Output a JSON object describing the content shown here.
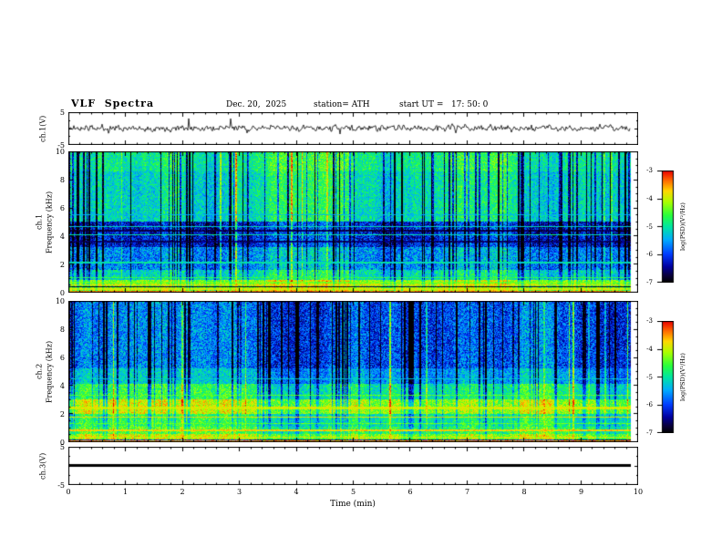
{
  "header": {
    "title": "VLF  Spectra",
    "date": "Dec. 20,  2025",
    "station": "station= ATH",
    "start_ut": "start UT =   17: 50: 0"
  },
  "x_axis": {
    "label": "Time  (min)",
    "range": [
      0,
      10
    ],
    "ticks": [
      "0",
      "1",
      "2",
      "3",
      "4",
      "5",
      "6",
      "7",
      "8",
      "9",
      "10"
    ],
    "minor_step": 0.2,
    "data_end": 9.87
  },
  "colorbar": {
    "label": "log(PSD)(V²/Hz)",
    "range": [
      -7,
      -3
    ],
    "ticks": [
      "-3",
      "-4",
      "-5",
      "-6",
      "-7"
    ],
    "stops": [
      {
        "t": 0.0,
        "c": [
          0,
          0,
          0
        ]
      },
      {
        "t": 0.06,
        "c": [
          10,
          0,
          60
        ]
      },
      {
        "t": 0.14,
        "c": [
          0,
          0,
          160
        ]
      },
      {
        "t": 0.25,
        "c": [
          0,
          60,
          255
        ]
      },
      {
        "t": 0.38,
        "c": [
          0,
          170,
          255
        ]
      },
      {
        "t": 0.5,
        "c": [
          0,
          230,
          160
        ]
      },
      {
        "t": 0.6,
        "c": [
          40,
          255,
          60
        ]
      },
      {
        "t": 0.72,
        "c": [
          170,
          255,
          0
        ]
      },
      {
        "t": 0.82,
        "c": [
          255,
          215,
          0
        ]
      },
      {
        "t": 0.91,
        "c": [
          255,
          110,
          0
        ]
      },
      {
        "t": 1.0,
        "c": [
          235,
          0,
          0
        ]
      }
    ]
  },
  "chart_data": [
    {
      "id": "ch1-waveform",
      "type": "line",
      "ylabel": "ch.1(V)",
      "yrange": [
        -5,
        5
      ],
      "yticks": [
        "5",
        "-5"
      ],
      "xlabel": "Time (min)",
      "x_range": [
        0,
        10
      ],
      "summary": "Channel 1 voltage time series: dense broadband noise centered on 0 V, typical excursions ±1.5 V with sferic spikes to about ±4 V over 0-9.9 min",
      "sim": {
        "seed": 11,
        "sigma": 1.0,
        "spike_prob": 0.012,
        "spike_amp": 2.6,
        "clip": 4.6
      }
    },
    {
      "id": "ch1-spectrogram",
      "type": "heatmap",
      "ylabel": [
        "ch.1",
        "Frequency  (kHz)"
      ],
      "yrange": [
        0,
        10
      ],
      "yticks": [
        "0",
        "2",
        "4",
        "6",
        "8",
        "10"
      ],
      "value_label": "log(PSD)(V²/Hz)",
      "value_range": [
        -7,
        -3
      ],
      "xlabel": "Time (min)",
      "x_range": [
        0,
        10
      ],
      "summary": "Channel 1 VLF power spectral density: green background (~-5) above 5 kHz with dense dark vertical sferic streaks, dark blue band 3-5 kHz with narrow interference lines, bright yellow/orange bands below 1 kHz",
      "sim": {
        "seed": 7,
        "bands": [
          {
            "f0": 0.0,
            "f1": 0.12,
            "v": -6.3,
            "noise": 0.5
          },
          {
            "f0": 0.12,
            "f1": 0.85,
            "v": -4.1,
            "noise": 0.5
          },
          {
            "f0": 0.85,
            "f1": 1.6,
            "v": -5.0,
            "noise": 0.5
          },
          {
            "f0": 1.6,
            "f1": 3.2,
            "v": -5.5,
            "noise": 0.6
          },
          {
            "f0": 3.2,
            "f1": 5.0,
            "v": -6.1,
            "noise": 0.6
          },
          {
            "f0": 5.0,
            "f1": 8.6,
            "v": -5.0,
            "noise": 0.5
          },
          {
            "f0": 8.6,
            "f1": 10.0,
            "v": -4.8,
            "noise": 0.5
          }
        ],
        "lines": [
          {
            "f": 0.05,
            "v": -3.4,
            "w": 0.05
          },
          {
            "f": 0.22,
            "v": -3.9,
            "w": 0.04
          },
          {
            "f": 0.38,
            "v": -6.8,
            "w": 0.03
          },
          {
            "f": 0.5,
            "v": -3.8,
            "w": 0.04
          },
          {
            "f": 0.68,
            "v": -4.3,
            "w": 0.04
          },
          {
            "f": 1.05,
            "v": -4.6,
            "w": 0.05
          },
          {
            "f": 2.1,
            "v": -5.0,
            "w": 0.05
          },
          {
            "f": 3.6,
            "v": -6.6,
            "w": 0.06
          },
          {
            "f": 4.1,
            "v": -5.0,
            "w": 0.05
          },
          {
            "f": 4.4,
            "v": -6.7,
            "w": 0.05
          },
          {
            "f": 4.7,
            "v": -5.1,
            "w": 0.04
          },
          {
            "f": 5.5,
            "v": -5.3,
            "w": 0.04
          }
        ],
        "streaks": {
          "density": 0.16,
          "min": 1.0,
          "max": 2.4,
          "bright_prob_rel": 0.12,
          "fmin": 2.5
        }
      }
    },
    {
      "id": "ch2-spectrogram",
      "type": "heatmap",
      "ylabel": [
        "ch.2",
        "Frequency  (kHz)"
      ],
      "yrange": [
        0,
        10
      ],
      "yticks": [
        "0",
        "2",
        "4",
        "6",
        "8",
        "10"
      ],
      "value_label": "log(PSD)(V²/Hz)",
      "value_range": [
        -7,
        -3
      ],
      "xlabel": "Time (min)",
      "x_range": [
        0,
        10
      ],
      "summary": "Channel 2 VLF power spectral density: blue background (~-6) above 5 kHz with dark vertical sferic streaks, yellow-green banded structure 0.2-4 kHz, bright yellow band near 2-3 kHz, orange/red narrow lines below 1 kHz",
      "sim": {
        "seed": 23,
        "bands": [
          {
            "f0": 0.0,
            "f1": 0.18,
            "v": -6.4,
            "noise": 0.5
          },
          {
            "f0": 0.18,
            "f1": 0.55,
            "v": -4.2,
            "noise": 0.5
          },
          {
            "f0": 0.55,
            "f1": 1.05,
            "v": -4.7,
            "noise": 0.5
          },
          {
            "f0": 1.05,
            "f1": 2.0,
            "v": -4.9,
            "noise": 0.5
          },
          {
            "f0": 2.0,
            "f1": 3.0,
            "v": -4.2,
            "noise": 0.5
          },
          {
            "f0": 3.0,
            "f1": 4.1,
            "v": -4.9,
            "noise": 0.5
          },
          {
            "f0": 4.1,
            "f1": 5.2,
            "v": -5.5,
            "noise": 0.5
          },
          {
            "f0": 5.2,
            "f1": 10.0,
            "v": -5.9,
            "noise": 0.6
          }
        ],
        "lines": [
          {
            "f": 0.06,
            "v": -3.5,
            "w": 0.05
          },
          {
            "f": 0.3,
            "v": -3.9,
            "w": 0.04
          },
          {
            "f": 0.8,
            "v": -3.7,
            "w": 0.05
          },
          {
            "f": 1.3,
            "v": -4.4,
            "w": 0.04
          },
          {
            "f": 1.75,
            "v": -3.8,
            "w": 0.05
          },
          {
            "f": 2.4,
            "v": -3.9,
            "w": 0.07
          },
          {
            "f": 3.3,
            "v": -4.4,
            "w": 0.04
          },
          {
            "f": 4.5,
            "v": -5.2,
            "w": 0.04
          }
        ],
        "streaks": {
          "density": 0.14,
          "min": 0.8,
          "max": 1.8,
          "bright_prob_rel": 0.08,
          "fmin": 4.5
        }
      }
    },
    {
      "id": "ch3-waveform",
      "type": "line",
      "ylabel": "ch.3(V)",
      "yrange": [
        -5,
        5
      ],
      "yticks": [
        "5",
        "-5"
      ],
      "xlabel": "Time (min)",
      "x_range": [
        0,
        10
      ],
      "value": 0,
      "summary": "Channel 3 voltage time series: constant 0 V (flat thick black line) over 0-9.9 min"
    }
  ]
}
